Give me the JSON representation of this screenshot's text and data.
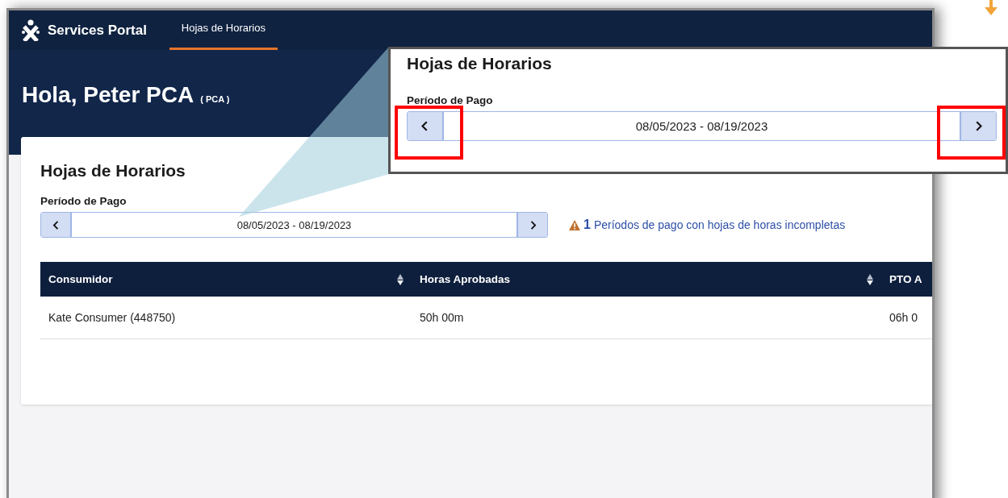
{
  "nav": {
    "brand": "Services Portal",
    "tabs": [
      {
        "label": "Hojas de Horarios",
        "selected": true
      }
    ]
  },
  "greeting": {
    "name": "Hola, Peter PCA",
    "role": "( PCA )"
  },
  "card": {
    "title": "Hojas de Horarios",
    "period_label": "Período de Pago",
    "period": "08/05/2023 - 08/19/2023",
    "alert": {
      "count": "1",
      "text": "Períodos de pago con hojas de horas incompletas"
    }
  },
  "table": {
    "columns": [
      {
        "label": "Consumidor",
        "sortable": true
      },
      {
        "label": "Horas Aprobadas",
        "sortable": true
      },
      {
        "label": "PTO A"
      }
    ],
    "rows": [
      [
        "Kate Consumer (448750)",
        "50h 00m",
        "06h 0"
      ]
    ]
  },
  "callout": {
    "title": "Hojas de Horarios",
    "period_label": "Período de Pago",
    "period": "08/05/2023 - 08/19/2023",
    "highlight_prev": true,
    "highlight_next": true
  }
}
